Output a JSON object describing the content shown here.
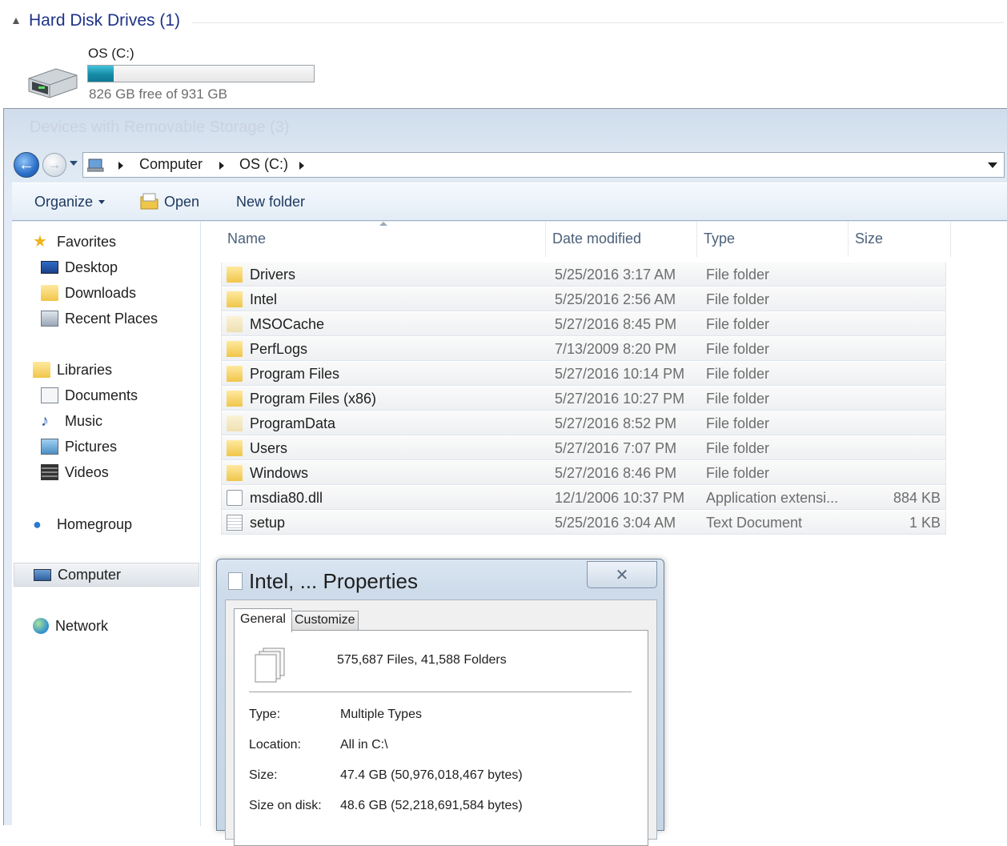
{
  "background": {
    "group_title": "Hard Disk Drives (1)",
    "drive_name": "OS (C:)",
    "drive_free": "826 GB free of 931 GB",
    "drive_used_fraction": 0.113,
    "ghost_group": "Devices with Removable Storage (3)"
  },
  "address": {
    "crumbs": [
      "Computer",
      "OS (C:)"
    ]
  },
  "toolbar": {
    "organize": "Organize",
    "open": "Open",
    "new_folder": "New folder"
  },
  "nav": {
    "favorites": "Favorites",
    "desktop": "Desktop",
    "downloads": "Downloads",
    "recent": "Recent Places",
    "libraries": "Libraries",
    "documents": "Documents",
    "music": "Music",
    "pictures": "Pictures",
    "videos": "Videos",
    "homegroup": "Homegroup",
    "computer": "Computer",
    "network": "Network"
  },
  "columns": {
    "name": "Name",
    "date": "Date modified",
    "type": "Type",
    "size": "Size"
  },
  "files": [
    {
      "name": "Drivers",
      "date": "5/25/2016 3:17 AM",
      "type": "File folder",
      "size": ""
    },
    {
      "name": "Intel",
      "date": "5/25/2016 2:56 AM",
      "type": "File folder",
      "size": ""
    },
    {
      "name": "MSOCache",
      "date": "5/27/2016 8:45 PM",
      "type": "File folder",
      "size": ""
    },
    {
      "name": "PerfLogs",
      "date": "7/13/2009 8:20 PM",
      "type": "File folder",
      "size": ""
    },
    {
      "name": "Program Files",
      "date": "5/27/2016 10:14 PM",
      "type": "File folder",
      "size": ""
    },
    {
      "name": "Program Files (x86)",
      "date": "5/27/2016 10:27 PM",
      "type": "File folder",
      "size": ""
    },
    {
      "name": "ProgramData",
      "date": "5/27/2016 8:52 PM",
      "type": "File folder",
      "size": ""
    },
    {
      "name": "Users",
      "date": "5/27/2016 7:07 PM",
      "type": "File folder",
      "size": ""
    },
    {
      "name": "Windows",
      "date": "5/27/2016 8:46 PM",
      "type": "File folder",
      "size": ""
    },
    {
      "name": "msdia80.dll",
      "date": "12/1/2006 10:37 PM",
      "type": "Application extensi...",
      "size": "884 KB"
    },
    {
      "name": "setup",
      "date": "5/25/2016 3:04 AM",
      "type": "Text Document",
      "size": "1 KB"
    }
  ],
  "dialog": {
    "title": "Intel, ... Properties",
    "close": "✕",
    "tab_general": "General",
    "tab_customize": "Customize",
    "summary": "575,687 Files, 41,588 Folders",
    "type_label": "Type:",
    "type_value": "Multiple Types",
    "location_label": "Location:",
    "location_value": "All in C:\\",
    "size_label": "Size:",
    "size_value": "47.4 GB (50,976,018,467 bytes)",
    "disk_label": "Size on disk:",
    "disk_value": "48.6 GB (52,218,691,584 bytes)"
  }
}
